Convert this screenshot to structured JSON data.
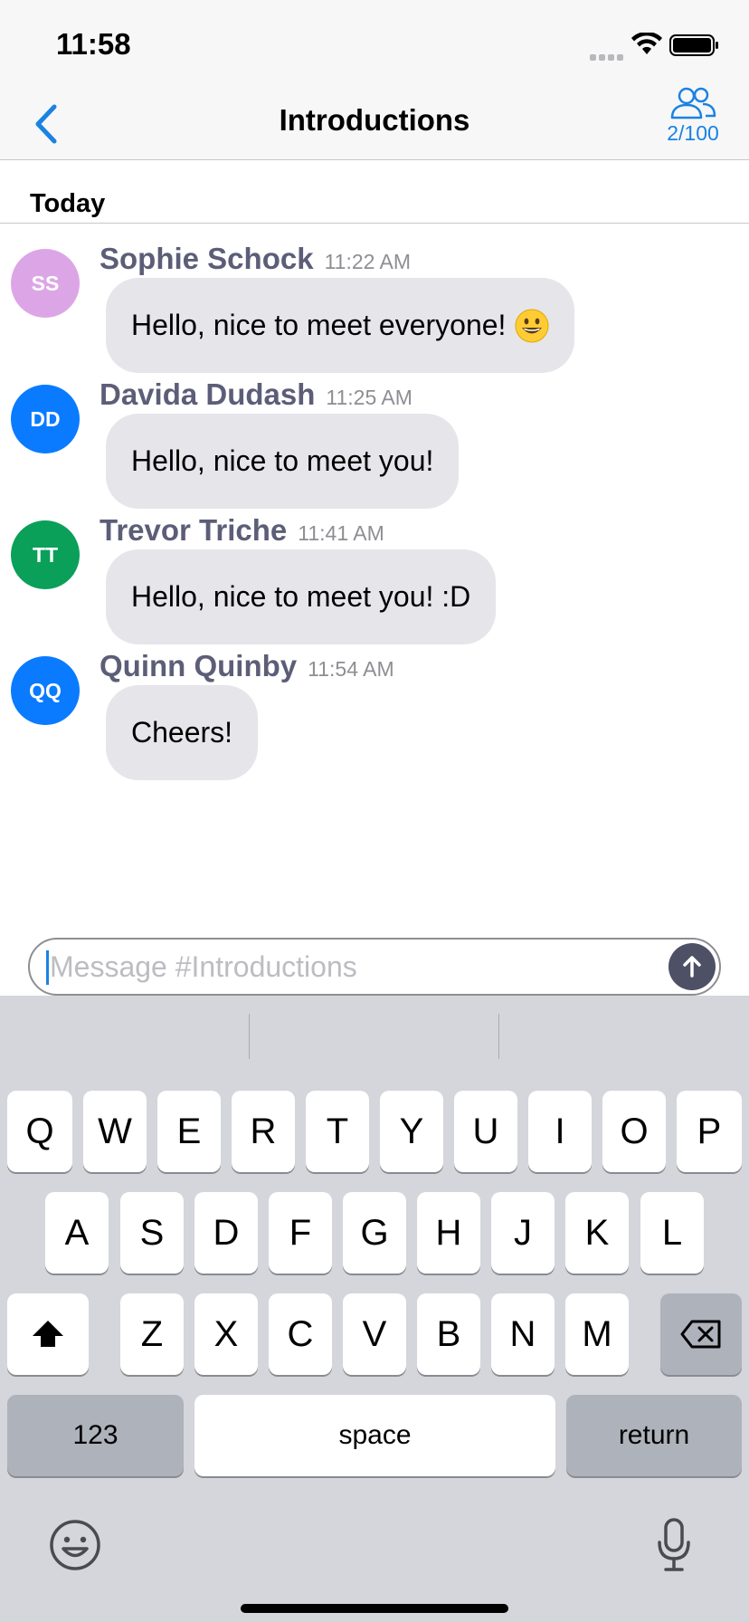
{
  "status_bar": {
    "time": "11:58"
  },
  "nav": {
    "title": "Introductions",
    "members_count": "2/100"
  },
  "day_label": "Today",
  "messages": [
    {
      "initials": "SS",
      "sender": "Sophie Schock",
      "time": "11:22 AM",
      "text": "Hello, nice to meet everyone!",
      "avatar_color": "#dca6e6",
      "emoji": "grinning-face-emoji"
    },
    {
      "initials": "DD",
      "sender": "Davida Dudash",
      "time": "11:25 AM",
      "text": "Hello, nice to meet you!",
      "avatar_color": "#0a7bff"
    },
    {
      "initials": "TT",
      "sender": "Trevor Triche",
      "time": "11:41 AM",
      "text": "Hello, nice to meet you! :D",
      "avatar_color": "#0aa05a"
    },
    {
      "initials": "QQ",
      "sender": "Quinn Quinby",
      "time": "11:54 AM",
      "text": "Cheers!",
      "avatar_color": "#0a7bff"
    }
  ],
  "composer": {
    "placeholder": "Message #Introductions",
    "value": ""
  },
  "keyboard": {
    "row1": [
      "Q",
      "W",
      "E",
      "R",
      "T",
      "Y",
      "U",
      "I",
      "O",
      "P"
    ],
    "row2": [
      "A",
      "S",
      "D",
      "F",
      "G",
      "H",
      "J",
      "K",
      "L"
    ],
    "row3": [
      "Z",
      "X",
      "C",
      "V",
      "B",
      "N",
      "M"
    ],
    "numbers_label": "123",
    "space_label": "space",
    "return_label": "return"
  },
  "colors": {
    "accent": "#1a82e2",
    "bubble": "#e5e5ea",
    "sender": "#5c5e78",
    "send_button": "#4e5066"
  }
}
